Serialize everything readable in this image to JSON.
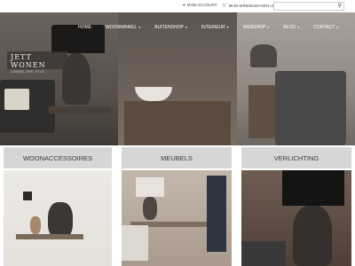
{
  "header": {
    "account_label": "MIJN ACCOUNT",
    "cart_label": "MIJN WINKELWAGEN LEEG",
    "search_placeholder": "",
    "search_icon": "search-icon",
    "user_icon": "user-icon",
    "cart_icon": "cart-icon"
  },
  "nav": {
    "items": [
      {
        "label": "HOME",
        "has_dropdown": false
      },
      {
        "label": "WOONWINKEL",
        "has_dropdown": true
      },
      {
        "label": "BUITENSHOP",
        "has_dropdown": true
      },
      {
        "label": "INTERIEUR",
        "has_dropdown": true
      },
      {
        "label": "WEBSHOP",
        "has_dropdown": true
      },
      {
        "label": "BLOG",
        "has_dropdown": true
      },
      {
        "label": "CONTACT",
        "has_dropdown": true
      }
    ]
  },
  "logo": {
    "name": "JETT WONEN",
    "tagline": "LANDELIJKE STIJL"
  },
  "categories": [
    {
      "label": "WOONACCESSOIRES"
    },
    {
      "label": "MEUBELS"
    },
    {
      "label": "VERLICHTING"
    }
  ]
}
